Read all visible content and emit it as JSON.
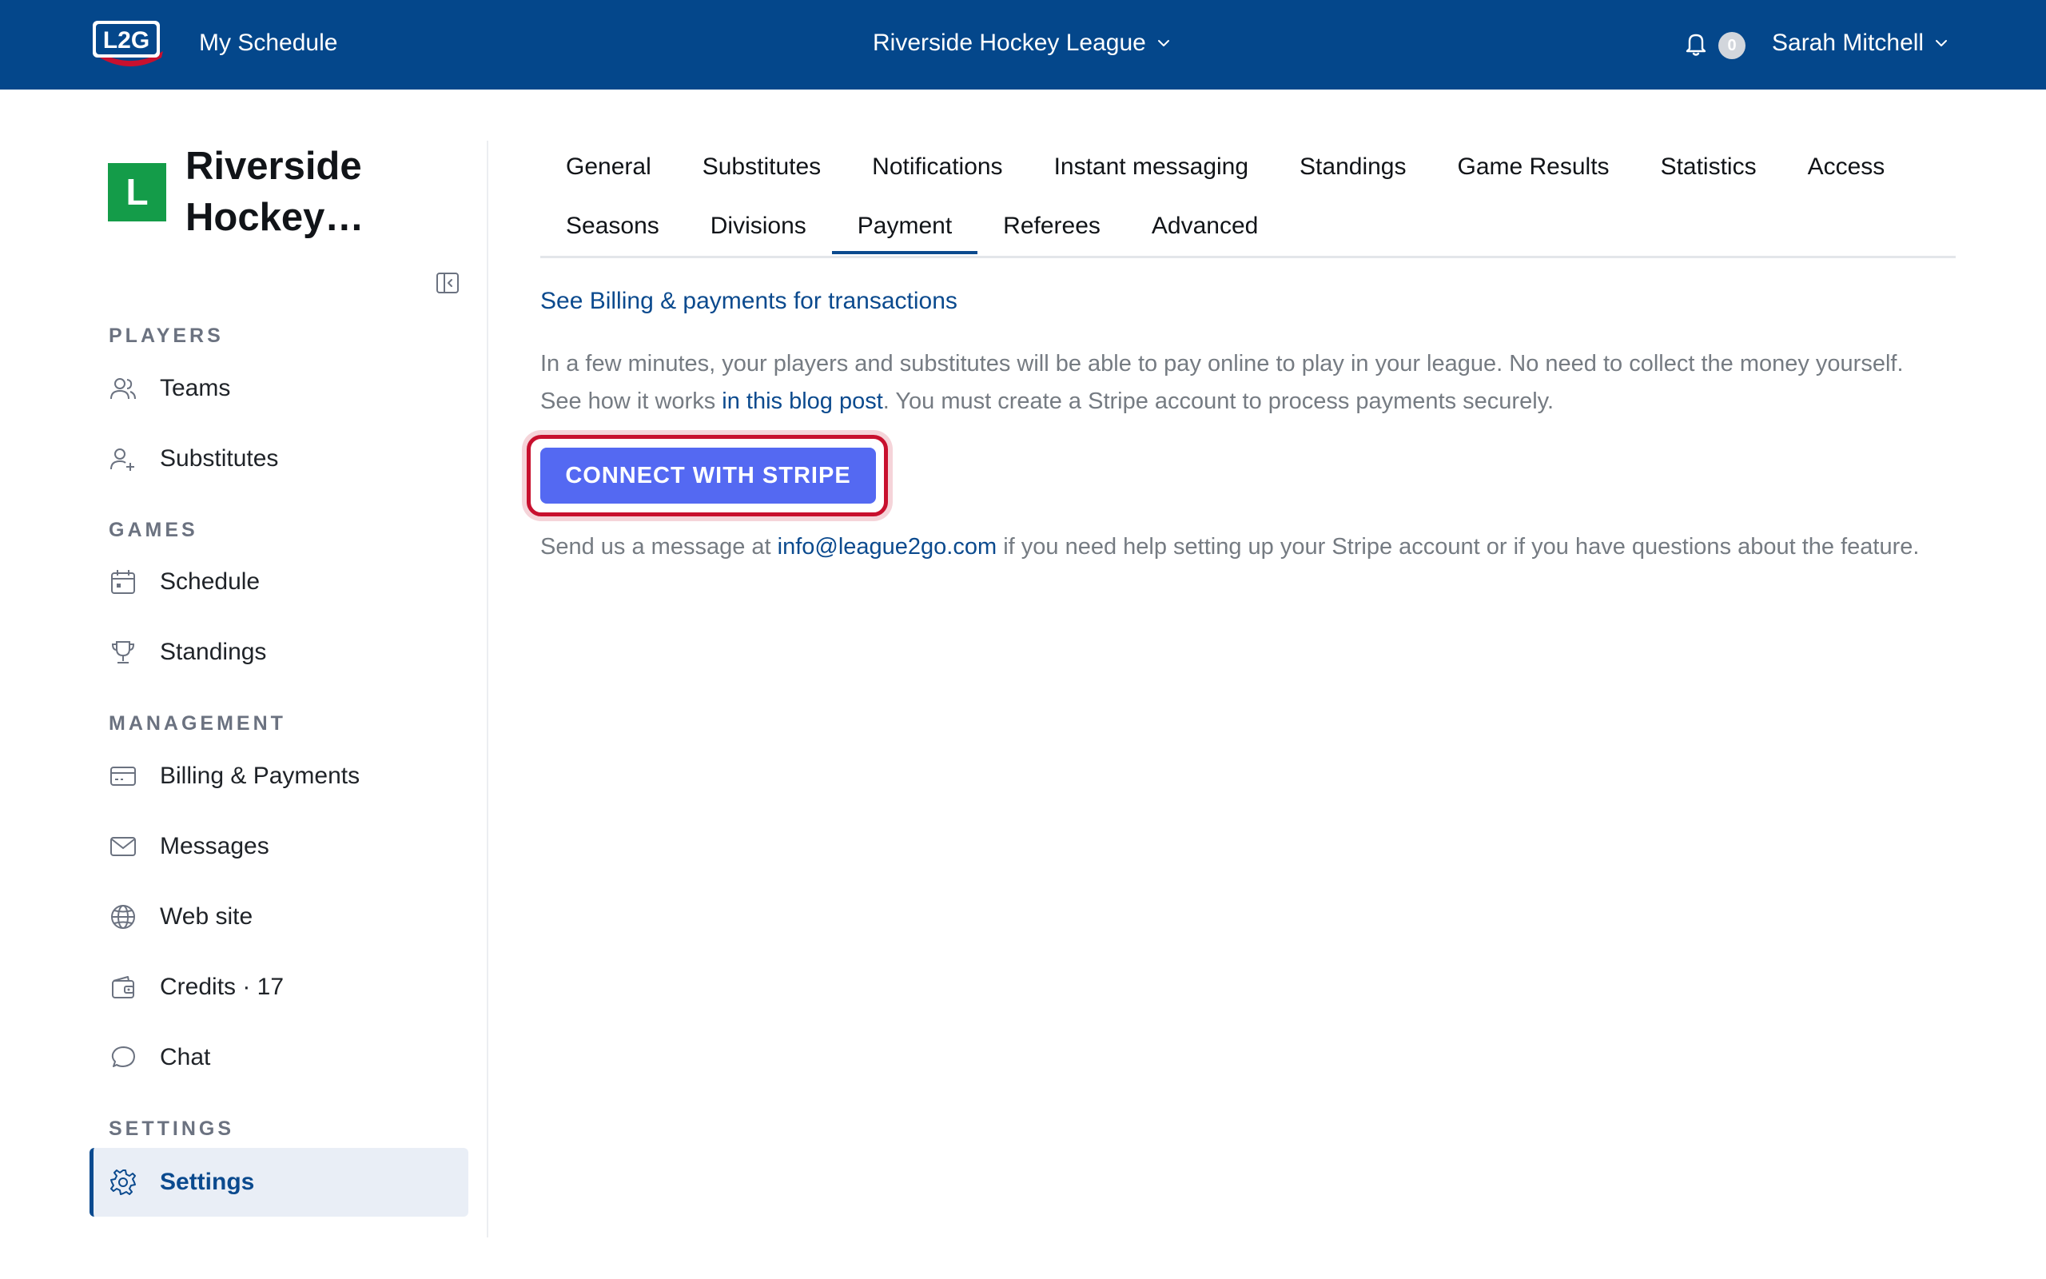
{
  "topbar": {
    "logo_text": "L2G",
    "my_schedule": "My Schedule",
    "league_select": "Riverside Hockey League",
    "notification_count": "0",
    "user_name": "Sarah Mitchell",
    "brand_color": "#04478b"
  },
  "sidebar": {
    "league_initial": "L",
    "league_name": "Riverside Hockey…",
    "sections": {
      "players": "PLAYERS",
      "games": "GAMES",
      "management": "MANAGEMENT",
      "settings": "SETTINGS"
    },
    "items": {
      "teams": "Teams",
      "substitutes": "Substitutes",
      "schedule": "Schedule",
      "standings": "Standings",
      "billing": "Billing & Payments",
      "messages": "Messages",
      "website": "Web site",
      "credits": "Credits · 17",
      "chat": "Chat",
      "settings": "Settings"
    }
  },
  "tabs": {
    "row1": [
      "General",
      "Substitutes",
      "Notifications",
      "Instant messaging",
      "Standings",
      "Game Results",
      "Statistics",
      "Access"
    ],
    "row2": [
      "Seasons",
      "Divisions",
      "Payment",
      "Referees",
      "Advanced"
    ],
    "active": "Payment"
  },
  "payment": {
    "billing_link": "See Billing & payments for transactions",
    "intro_before_link": "In a few minutes, your players and substitutes will be able to pay online to play in your league. No need to collect the money yourself. See how it works ",
    "blog_link": "in this blog post",
    "intro_after_link": ". You must create a Stripe account to process payments securely.",
    "stripe_button": "CONNECT WITH STRIPE",
    "help_before": "Send us a message at ",
    "help_email": "info@league2go.com",
    "help_after": " if you need help setting up your Stripe account or if you have questions about the feature.",
    "stripe_color": "#5469f2",
    "highlight_color": "#c8102e"
  }
}
